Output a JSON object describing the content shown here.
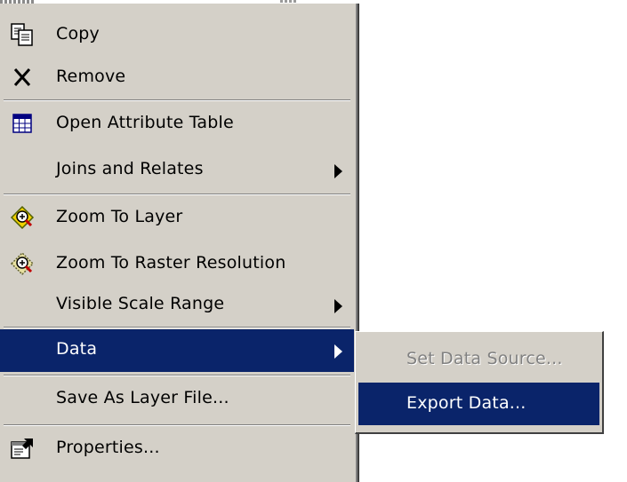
{
  "menu": {
    "items": [
      {
        "label": "Copy",
        "icon": "copy-icon"
      },
      {
        "label": "Remove",
        "icon": "remove-icon"
      },
      {
        "label": "Open Attribute Table",
        "icon": "table-icon"
      },
      {
        "label": "Joins and Relates",
        "has_submenu": true
      },
      {
        "label": "Zoom To Layer",
        "icon": "zoom-to-layer-icon"
      },
      {
        "label": "Zoom To Raster Resolution",
        "icon": "zoom-to-raster-icon"
      },
      {
        "label": "Visible Scale Range",
        "has_submenu": true
      },
      {
        "label": "Data",
        "has_submenu": true,
        "highlighted": true
      },
      {
        "label": "Save As Layer File..."
      },
      {
        "label": "Properties...",
        "icon": "properties-icon"
      }
    ]
  },
  "submenu": {
    "items": [
      {
        "label": "Set Data Source...",
        "disabled": true
      },
      {
        "label": "Export Data...",
        "highlighted": true
      }
    ]
  },
  "colors": {
    "menu_background": "#d4d0c8",
    "highlight": "#0a246a",
    "highlight_text": "#ffffff",
    "disabled_text": "#808080"
  }
}
